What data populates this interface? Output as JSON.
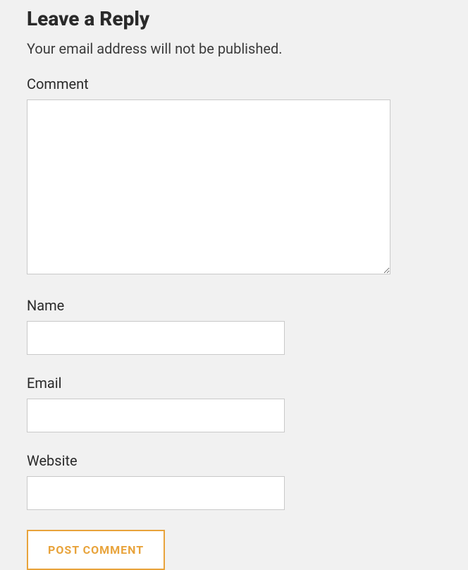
{
  "form": {
    "title": "Leave a Reply",
    "note": "Your email address will not be published.",
    "fields": {
      "comment": {
        "label": "Comment",
        "value": ""
      },
      "name": {
        "label": "Name",
        "value": ""
      },
      "email": {
        "label": "Email",
        "value": ""
      },
      "website": {
        "label": "Website",
        "value": ""
      }
    },
    "submit_label": "POST COMMENT"
  }
}
